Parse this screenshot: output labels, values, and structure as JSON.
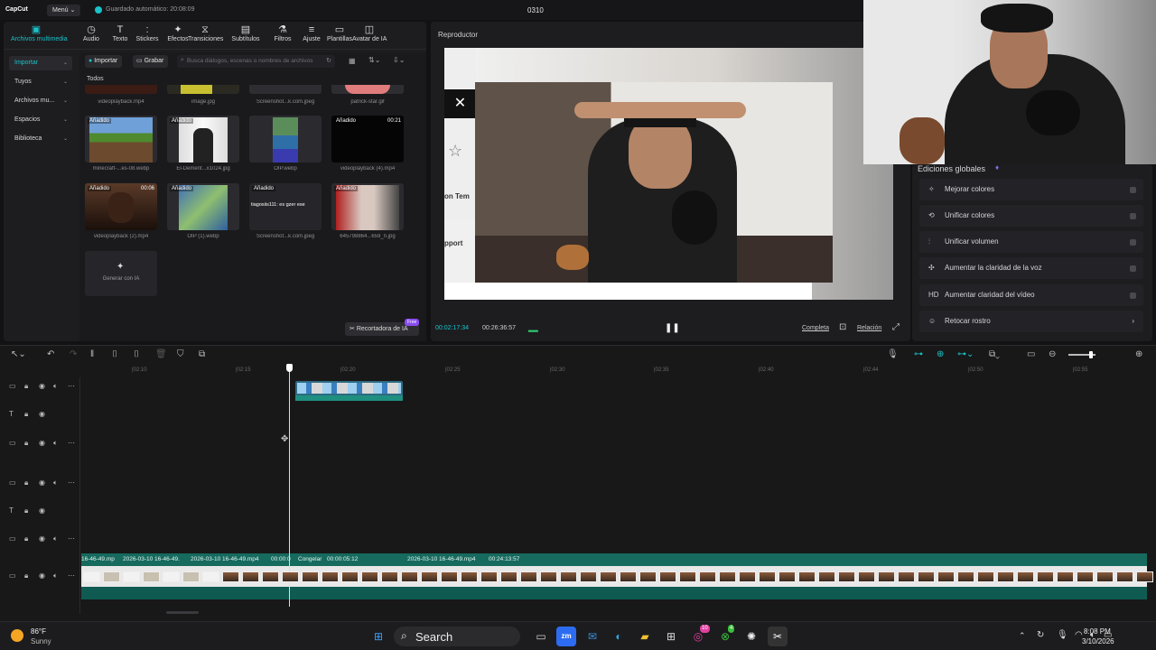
{
  "titlebar": {
    "logo": "CapCut",
    "menu": "Menú",
    "autosave": "Guardado automático: 20:08:09",
    "project": "0310"
  },
  "toolbar": [
    {
      "label": "Archivos multimedia",
      "icon": "media-icon"
    },
    {
      "label": "Audio",
      "icon": "audio-icon"
    },
    {
      "label": "Texto",
      "icon": "text-icon"
    },
    {
      "label": "Stickers",
      "icon": "sticker-icon"
    },
    {
      "label": "Efectos",
      "icon": "effects-icon"
    },
    {
      "label": "Transiciones",
      "icon": "transition-icon"
    },
    {
      "label": "Subtítulos",
      "icon": "subtitle-icon"
    },
    {
      "label": "Filtros",
      "icon": "filter-icon"
    },
    {
      "label": "Ajuste",
      "icon": "adjust-icon"
    },
    {
      "label": "Plantillas",
      "icon": "template-icon"
    },
    {
      "label": "Avatar de IA",
      "icon": "avatar-icon"
    }
  ],
  "sidebar": [
    {
      "label": "Importar"
    },
    {
      "label": "Tuyos"
    },
    {
      "label": "Archivos mu..."
    },
    {
      "label": "Espacios"
    },
    {
      "label": "Biblioteca"
    }
  ],
  "media": {
    "import_btn": "Importar",
    "record_btn": "Grabar",
    "search_placeholder": "Busca diálogos, escenas o nombres de archivos",
    "section": "Todos",
    "top_row": [
      "videoplayback.mp4",
      "image.jpg",
      "Screenshot...k.com.jpeg",
      "patrick-star.gif"
    ],
    "items": [
      {
        "badge": "Añadido",
        "name": "minecraft-...es-08.webp",
        "dur": ""
      },
      {
        "badge": "Añadido",
        "name": "El-Dement...x1024.jpg",
        "dur": ""
      },
      {
        "badge": "",
        "name": "OIP.webp",
        "dur": ""
      },
      {
        "badge": "Añadido",
        "name": "videoplayback (4).mp4",
        "dur": "00:21"
      },
      {
        "badge": "Añadido",
        "name": "videoplayback (2).mp4",
        "dur": "00:06"
      },
      {
        "badge": "Añadido",
        "name": "OIP (1).webp",
        "dur": ""
      },
      {
        "badge": "Añadido",
        "name": "Screenshot...k.com.jpeg",
        "dur": "",
        "caption": "tiagosiis111: es gzer ese"
      },
      {
        "badge": "Añadido",
        "name": "645798864...659_n.jpg",
        "dur": ""
      }
    ],
    "generate": "Generar con IA",
    "cutter": "Recortadora de IA",
    "free": "Free"
  },
  "player": {
    "title": "Reproductor",
    "current": "00:02:17:34",
    "total": "00:26:36:57",
    "complete": "Completa",
    "ratio": "Relación",
    "overlay_left1": "on Tem",
    "overlay_left2": "pport"
  },
  "globals": {
    "title": "Ediciones globales",
    "items": [
      {
        "label": "Mejorar colores",
        "icon": "wand-icon"
      },
      {
        "label": "Unificar colores",
        "icon": "color-icon"
      },
      {
        "label": "Unificar volumen",
        "icon": "volume-bars-icon"
      },
      {
        "label": "Aumentar la claridad de la voz",
        "icon": "voice-icon"
      },
      {
        "label": "Aumentar claridad del vídeo",
        "icon": "hd-icon",
        "glyph": "HD"
      },
      {
        "label": "Retocar rostro",
        "icon": "face-icon"
      }
    ]
  },
  "timeline": {
    "ticks": [
      "|02:10",
      "|02:15",
      "|02:20",
      "|02:25",
      "|02:30",
      "|02:35",
      "|02:40",
      "|02:44",
      "|02:50",
      "|02:55"
    ],
    "clip_labels": [
      "16-46-49.mp",
      "2026-03-10 16-46-49.",
      "2026-03-10 16-46-49.mp4",
      "00:00:0",
      "Congelar",
      "00:00:05:12",
      "2026-03-10 16-46-49.mp4",
      "00:24:13:57"
    ]
  },
  "taskbar": {
    "temp": "86°F",
    "weather": "Sunny",
    "search": "Search",
    "time": "8:08 PM",
    "date": "3/10/2026",
    "badge1": "10",
    "badge2": "4"
  }
}
